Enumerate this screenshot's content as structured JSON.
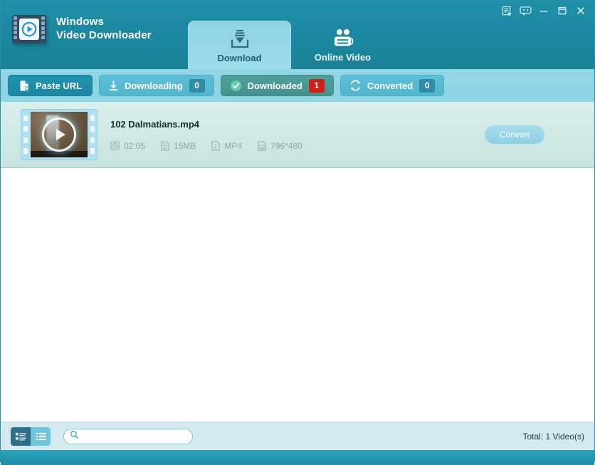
{
  "window": {
    "title_line1": "Windows",
    "title_line2": "Video Downloader",
    "controls": [
      {
        "name": "register-icon",
        "label": "Register"
      },
      {
        "name": "feedback-icon",
        "label": "Feedback"
      },
      {
        "name": "minimize-icon",
        "label": "Minimize"
      },
      {
        "name": "maximize-icon",
        "label": "Maximize"
      },
      {
        "name": "close-icon",
        "label": "Close"
      }
    ]
  },
  "main_tabs": [
    {
      "label": "Download",
      "icon": "download-icon",
      "active": true
    },
    {
      "label": "Online Video",
      "icon": "online-video-icon",
      "active": false
    }
  ],
  "toolbar": {
    "paste_url_label": "Paste URL",
    "paste_url_icon": "paste-icon",
    "filters": [
      {
        "label": "Downloading",
        "count": "0",
        "icon": "download-arrow-icon",
        "active": false,
        "badge_color": "#2f8ca4"
      },
      {
        "label": "Downloaded",
        "count": "1",
        "icon": "check-circle-icon",
        "active": true,
        "badge_color": "#d01f17"
      },
      {
        "label": "Converted",
        "count": "0",
        "icon": "convert-arrows-icon",
        "active": false,
        "badge_color": "#2f8ca4"
      }
    ]
  },
  "list": {
    "items": [
      {
        "filename": "102 Dalmatians.mp4",
        "duration": "02:05",
        "size": "15MB",
        "format": "MP4",
        "resolution": "796*480",
        "action_label": "Convert",
        "thumbnail_name": "video-thumbnail"
      }
    ]
  },
  "statusbar": {
    "view_grid_icon": "grid-view-icon",
    "view_list_icon": "list-view-icon",
    "search_placeholder": "",
    "search_value": "",
    "search_icon": "search-icon",
    "total_text": "Total: 1 Video(s)"
  },
  "colors": {
    "header_teal": "#1b87a0",
    "subbar_blue": "#8ed3e3",
    "active_filter": "#4f9f9a",
    "badge_red": "#d01f17",
    "row_mint": "#d5eae6",
    "statusbar": "#d5eaef"
  }
}
